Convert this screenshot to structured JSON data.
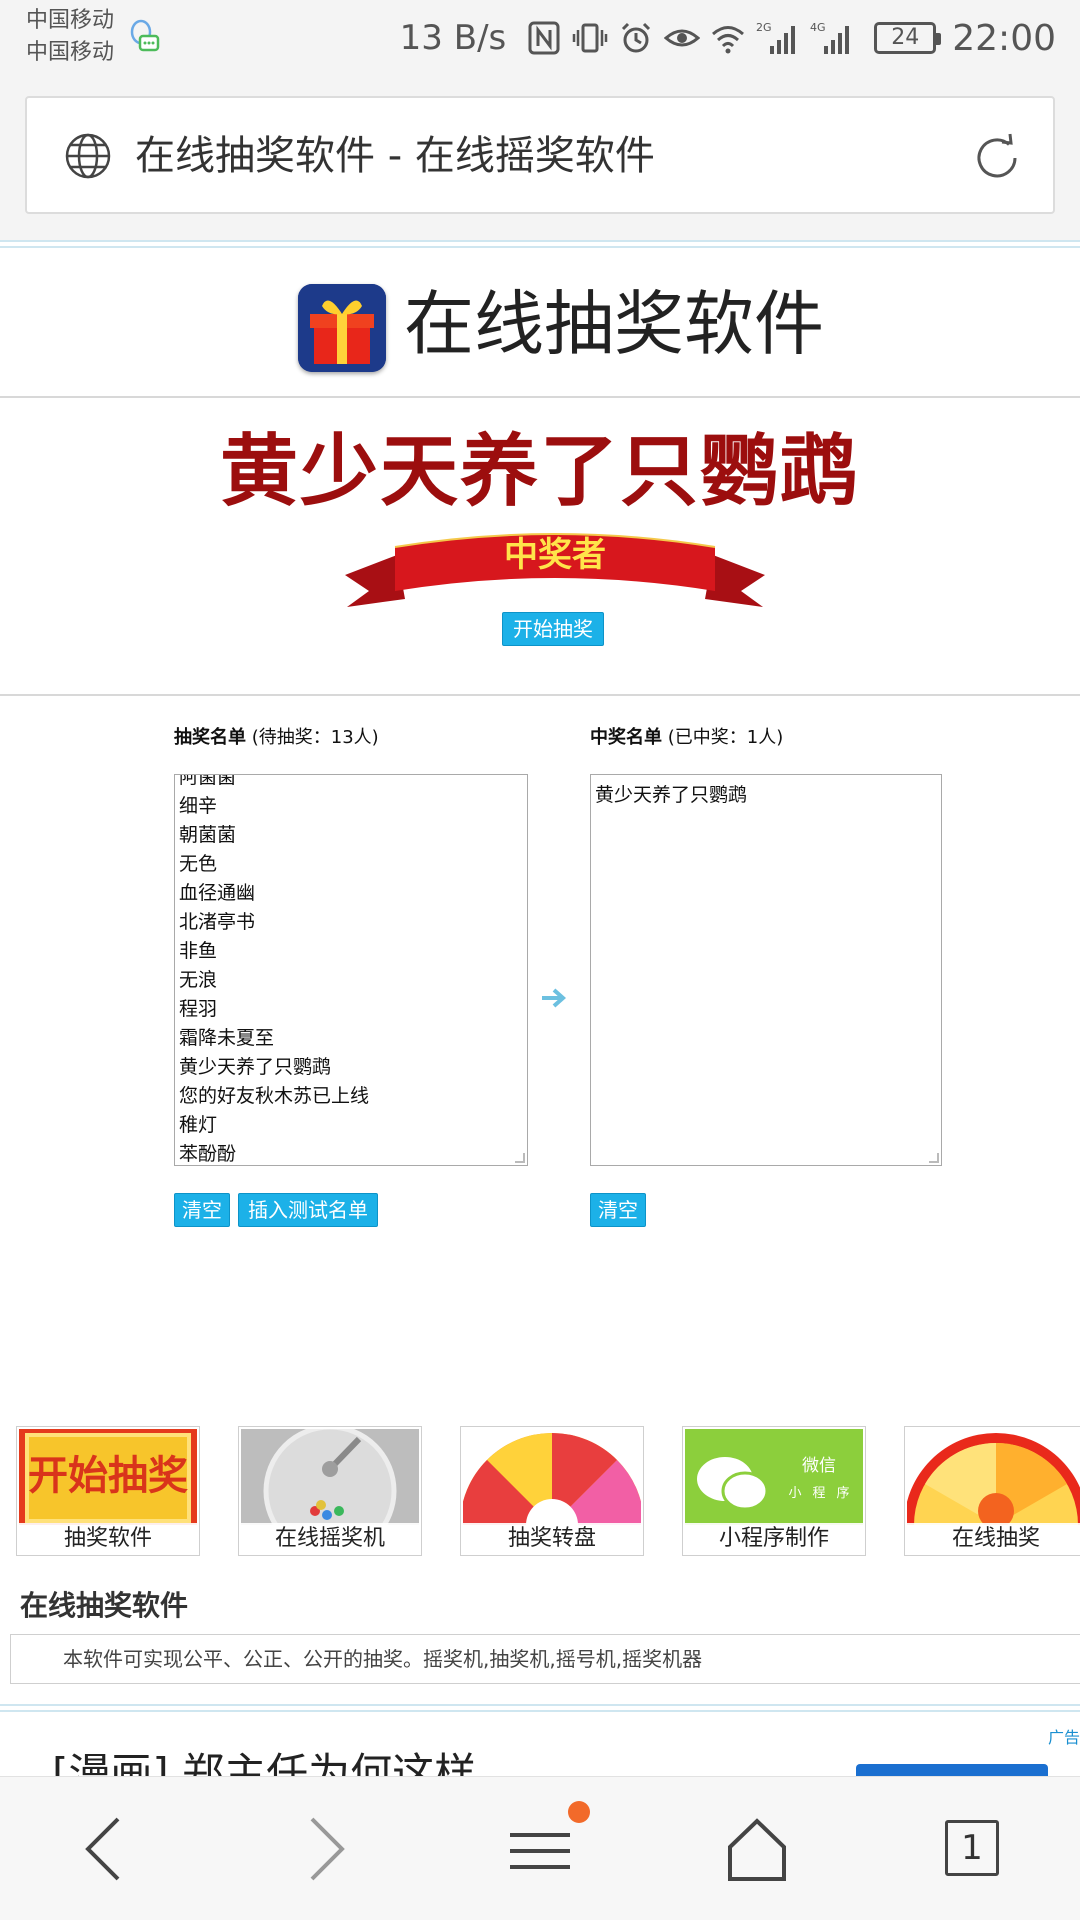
{
  "status_bar": {
    "carrier_1": "中国移动",
    "carrier_2": "中国移动",
    "net_speed": "13 B/s",
    "battery": "24",
    "time": "22:00"
  },
  "browser": {
    "page_title": "在线抽奖软件 - 在线摇奖软件"
  },
  "site": {
    "title": "在线抽奖软件",
    "winner_display": "黄少天养了只鹦鹉",
    "ribbon_label": "中奖者",
    "start_button": "开始抽奖"
  },
  "pending_list": {
    "heading_bold": "抽奖名单",
    "heading_note": "(待抽奖：13人)",
    "partial_top_item": "阿菌菌",
    "names": [
      "细辛",
      "朝菌菌",
      "无色",
      "血径通幽",
      "北渚亭书",
      "非鱼",
      "无浪",
      "程羽",
      "霜降未夏至",
      "黄少天养了只鹦鹉",
      "您的好友秋木苏已上线",
      "稚灯",
      "苯酚酚"
    ],
    "clear_button": "清空",
    "insert_button": "插入测试名单"
  },
  "winner_list": {
    "heading_bold": "中奖名单",
    "heading_note": "(已中奖：1人)",
    "names": [
      "黄少天养了只鹦鹉"
    ],
    "clear_button": "清空"
  },
  "thumbnails": [
    {
      "label": "抽奖软件",
      "overlay": "开始抽奖"
    },
    {
      "label": "在线摇奖机"
    },
    {
      "label": "抽奖转盘"
    },
    {
      "label": "小程序制作",
      "overlay": "微信"
    },
    {
      "label": "在线抽奖"
    }
  ],
  "thumbnail_overlay_small": [
    "小",
    "程",
    "序"
  ],
  "section": {
    "heading": "在线抽奖软件",
    "description": "本软件可实现公平、公正、公开的抽奖。摇奖机,抽奖机,摇号机,摇奖机器"
  },
  "ad": {
    "tag": "广告",
    "headline": "[漫画] 郑主任为何这样"
  },
  "bottom_nav": {
    "tab_count": "1"
  },
  "colors": {
    "accent_button": "#1cb1e8",
    "winner_red": "#9c0e0e",
    "ribbon_red": "#c8141a",
    "notification_dot": "#f26a2a"
  }
}
